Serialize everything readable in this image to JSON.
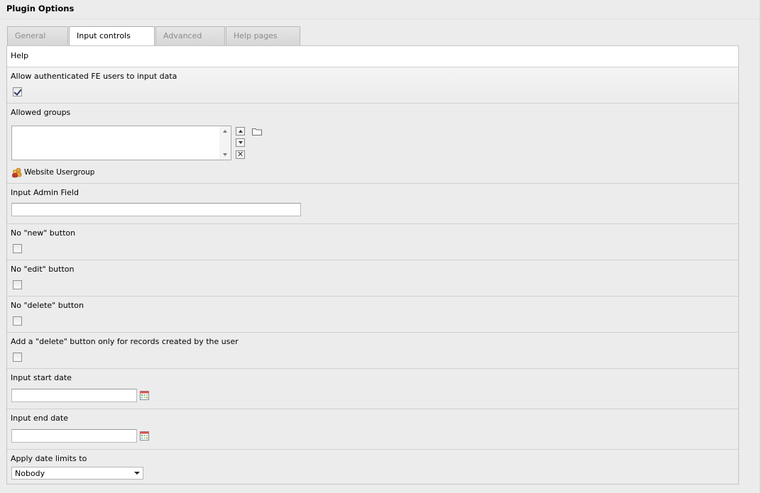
{
  "header": {
    "title": "Plugin Options"
  },
  "tabs": [
    {
      "label": "General",
      "active": false
    },
    {
      "label": "Input controls",
      "active": true
    },
    {
      "label": "Advanced",
      "active": false
    },
    {
      "label": "Help pages",
      "active": false
    }
  ],
  "form": {
    "help_label": "Help",
    "allow_fe": {
      "label": "Allow authenticated FE users to input data",
      "checked": true
    },
    "allowed_groups": {
      "label": "Allowed groups",
      "suggestion": "Website Usergroup",
      "icons": [
        "move-up-icon",
        "move-down-icon",
        "remove-icon",
        "folder-icon",
        "usergroup-icon"
      ]
    },
    "input_admin_field": {
      "label": "Input Admin Field",
      "value": ""
    },
    "no_new": {
      "label": "No \"new\" button",
      "checked": false
    },
    "no_edit": {
      "label": "No \"edit\" button",
      "checked": false
    },
    "no_delete": {
      "label": "No \"delete\" button",
      "checked": false
    },
    "delete_own": {
      "label": "Add a \"delete\" button only for records created by the user",
      "checked": false
    },
    "start_date": {
      "label": "Input start date",
      "value": ""
    },
    "end_date": {
      "label": "Input end date",
      "value": ""
    },
    "date_limits": {
      "label": "Apply date limits to",
      "selected": "Nobody"
    }
  },
  "colors": {
    "background": "#ececec",
    "tab_inactive_text": "#8b8b8b",
    "border": "#c4c4c4"
  }
}
